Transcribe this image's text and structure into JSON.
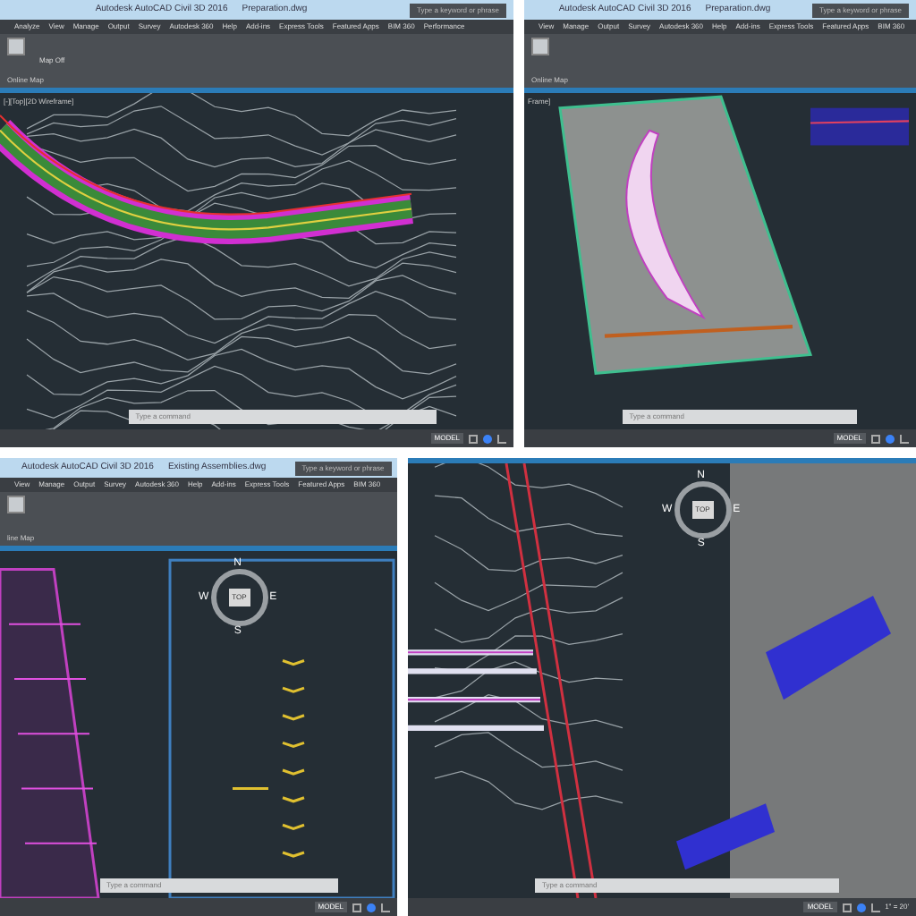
{
  "panels": [
    {
      "kind": "road-contours",
      "title": "Autodesk AutoCAD Civil 3D 2016",
      "file": "Preparation.dwg",
      "search": {
        "placeholder": "Type a keyword or phrase"
      },
      "tabs": [
        "Analyze",
        "View",
        "Manage",
        "Output",
        "Survey",
        "Autodesk 360",
        "Help",
        "Add-ins",
        "Express Tools",
        "Featured Apps",
        "BIM 360",
        "Performance"
      ],
      "ribbon_buttons": [
        "Map Off"
      ],
      "ribbon_panel": "Online Map",
      "viewport_label": "[-][Top][2D Wireframe]",
      "command": {
        "placeholder": "Type a command"
      },
      "status": "MODEL"
    },
    {
      "kind": "site-aerial",
      "title": "Autodesk AutoCAD Civil 3D 2016",
      "file": "Preparation.dwg",
      "search": {
        "placeholder": "Type a keyword or phrase"
      },
      "tabs": [
        "View",
        "Manage",
        "Output",
        "Survey",
        "Autodesk 360",
        "Help",
        "Add-ins",
        "Express Tools",
        "Featured Apps",
        "BIM 360"
      ],
      "ribbon_panel": "Online Map",
      "viewport_label": "Frame]",
      "command": {
        "placeholder": "Type a command"
      },
      "status": "MODEL"
    },
    {
      "kind": "assemblies",
      "title": "Autodesk AutoCAD Civil 3D 2016",
      "file": "Existing Assemblies.dwg",
      "search": {
        "placeholder": "Type a keyword or phrase"
      },
      "tabs": [
        "View",
        "Manage",
        "Output",
        "Survey",
        "Autodesk 360",
        "Help",
        "Add-ins",
        "Express Tools",
        "Featured Apps",
        "BIM 360"
      ],
      "ribbon_panel": "line Map",
      "compass": {
        "n": "N",
        "w": "W",
        "e": "E",
        "s": "S",
        "center": "TOP"
      },
      "command": {
        "placeholder": "Type a command"
      },
      "status": "MODEL"
    },
    {
      "kind": "intersection-3d",
      "compass": {
        "n": "N",
        "w": "W",
        "e": "E",
        "s": "S",
        "center": "TOP"
      },
      "command": {
        "placeholder": "Type a command"
      },
      "status": "MODEL",
      "scale": "1\" = 20'"
    }
  ]
}
